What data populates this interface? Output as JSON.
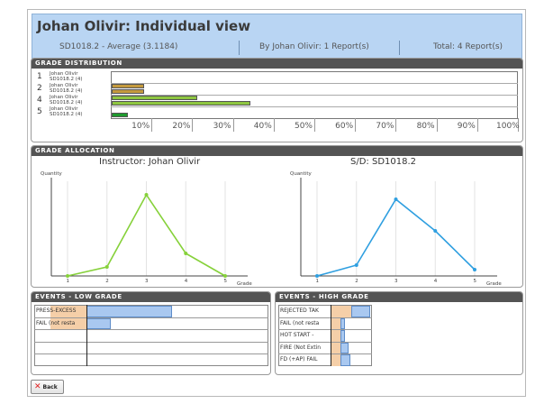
{
  "header": {
    "title": "Johan Olivir: Individual view",
    "average": "SD1018.2 - Average (3.1184)",
    "by": "By Johan Olivir: 1 Report(s)",
    "total": "Total: 4 Report(s)"
  },
  "distribution": {
    "heading": "GRADE DISTRIBUTION",
    "rows": [
      {
        "grade": "1",
        "label_a": "Johan Olivir",
        "label_b": "SD1018.2 (4)",
        "a": 0,
        "b": 0,
        "color": "#c49a3e"
      },
      {
        "grade": "2",
        "label_a": "Johan Olivir",
        "label_b": "SD1018.2 (4)",
        "a": 8,
        "b": 8,
        "color": "#c49a3e"
      },
      {
        "grade": "4",
        "label_a": "Johan Olivir",
        "label_b": "SD1018.2 (4)",
        "a": 21,
        "b": 34,
        "color": "#8ec640"
      },
      {
        "grade": "5",
        "label_a": "Johan Olivir",
        "label_b": "SD1018.2 (4)",
        "a": 0,
        "b": 4,
        "color": "#1e9a2e"
      }
    ],
    "ticks": [
      "10%",
      "20%",
      "30%",
      "40%",
      "50%",
      "60%",
      "70%",
      "80%",
      "90%",
      "100%"
    ]
  },
  "allocation": {
    "heading": "GRADE ALLOCATION",
    "ylabel": "Quantity",
    "xlabel": "Grade",
    "charts": [
      {
        "title": "Instructor: Johan Olivir",
        "color": "#86d13a",
        "values": [
          0,
          1,
          9,
          2.5,
          0
        ],
        "x": [
          "1",
          "2",
          "3",
          "4",
          "5"
        ]
      },
      {
        "title": "S/D: SD1018.2",
        "color": "#2f9fe0",
        "values": [
          0,
          1.2,
          8.5,
          5,
          0.7
        ],
        "x": [
          "1",
          "2",
          "3",
          "4",
          "5"
        ]
      }
    ],
    "ymax": 10
  },
  "chart_data": [
    {
      "type": "line",
      "title": "Instructor: Johan Olivir",
      "xlabel": "Grade",
      "ylabel": "Quantity",
      "x": [
        1,
        2,
        3,
        4,
        5
      ],
      "series": [
        {
          "values": [
            0,
            1,
            9,
            2.5,
            0
          ]
        }
      ]
    },
    {
      "type": "line",
      "title": "S/D: SD1018.2",
      "xlabel": "Grade",
      "ylabel": "Quantity",
      "x": [
        1,
        2,
        3,
        4,
        5
      ],
      "series": [
        {
          "values": [
            0,
            1.2,
            8.5,
            5,
            0.7
          ]
        }
      ]
    }
  ],
  "events_low": {
    "heading": "EVENTS - LOW GRADE",
    "rows": [
      {
        "label": "PRESS-EXCESS",
        "orange": 40,
        "blue": 95
      },
      {
        "label": "FAIL (not resta",
        "orange": 40,
        "blue": 27
      },
      {
        "label": "",
        "orange": 0,
        "blue": 0
      },
      {
        "label": "",
        "orange": 0,
        "blue": 0
      },
      {
        "label": "",
        "orange": 0,
        "blue": 0
      }
    ]
  },
  "events_high": {
    "heading": "EVENTS - HIGH GRADE",
    "rows": [
      {
        "label": "REJECTED TAK",
        "orange": 23,
        "blue": 21
      },
      {
        "label": "FAIL (not resta",
        "orange": 11,
        "blue": 5
      },
      {
        "label": "HOT START -",
        "orange": 11,
        "blue": 5
      },
      {
        "label": "FIRE (Not Extin",
        "orange": 11,
        "blue": 9
      },
      {
        "label": "FD (+AP) FAIL",
        "orange": 11,
        "blue": 11
      }
    ]
  },
  "back_label": "Back"
}
